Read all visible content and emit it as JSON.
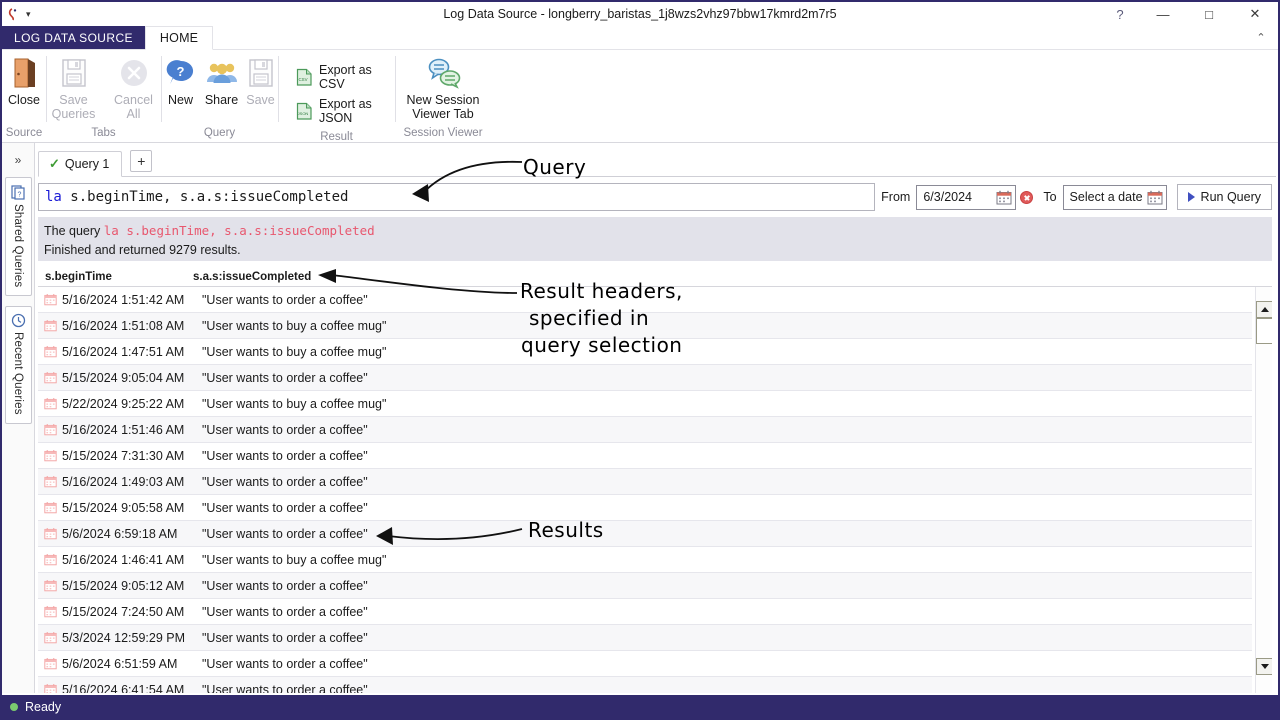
{
  "window": {
    "title": "Log Data Source - longberry_baristas_1j8wzs2vhz97bbw17kmrd2m7r5",
    "help_icon": "?",
    "minimize_icon": "—",
    "maximize_icon": "□",
    "close_icon": "✕",
    "qat_dropdown_icon": "▾",
    "ribbon_collapse_icon": "⌃",
    "accent_color": "#312a6c"
  },
  "ribbon": {
    "file_tab": "LOG DATA SOURCE",
    "home_tab": "HOME",
    "groups": [
      {
        "label": "Source",
        "buttons": [
          {
            "label": "Close",
            "icon": "door-icon",
            "disabled": false
          }
        ]
      },
      {
        "label": "Tabs",
        "buttons": [
          {
            "label": "Save\nQueries",
            "line1": "Save",
            "line2": "Queries",
            "icon": "floppy-disk-icon",
            "disabled": true
          },
          {
            "label": "Cancel\nAll",
            "line1": "Cancel",
            "line2": "All",
            "icon": "cancel-circle-icon",
            "disabled": true
          }
        ]
      },
      {
        "label": "Query",
        "buttons": [
          {
            "label": "New",
            "icon": "question-bubble-icon",
            "disabled": false
          },
          {
            "label": "Share",
            "icon": "people-icon",
            "disabled": false
          },
          {
            "label": "Save",
            "icon": "floppy-disk-icon",
            "disabled": true
          }
        ]
      },
      {
        "label": "Result",
        "small_buttons": [
          {
            "label": "Export as CSV",
            "icon": "csv-file-icon"
          },
          {
            "label": "Export as JSON",
            "icon": "json-file-icon"
          }
        ]
      },
      {
        "label": "Session Viewer",
        "buttons": [
          {
            "label": "New Session\nViewer Tab",
            "line1": "New Session",
            "line2": "Viewer Tab",
            "icon": "chat-bubbles-icon",
            "disabled": false
          }
        ]
      }
    ]
  },
  "rail": {
    "expand_icon": "»",
    "tabs": [
      {
        "label": "Shared Queries",
        "icon": "shared-queries-icon"
      },
      {
        "label": "Recent Queries",
        "icon": "clock-icon"
      }
    ]
  },
  "query_tabs": {
    "tabs": [
      {
        "label": "Query 1",
        "status_icon": "check-icon"
      }
    ],
    "add_tab_icon": "+"
  },
  "query_bar": {
    "keyword": "la",
    "rest": " s.beginTime, s.a.s:issueCompleted",
    "from_label": "From",
    "from_value": "6/3/2024",
    "to_label": "To",
    "to_placeholder": "Select a date",
    "calendar_icon": "calendar-icon",
    "clear_icon": "clear-date-icon",
    "run_label": "Run Query",
    "run_icon": "play-icon"
  },
  "status_block": {
    "prefix": "The query ",
    "query_text": "la s.beginTime, s.a.s:issueCompleted",
    "result_line": "Finished and returned 9279 results."
  },
  "results": {
    "headers": [
      "s.beginTime",
      "s.a.s:issueCompleted"
    ],
    "row_icon": "calendar-icon",
    "rows": [
      {
        "time": "5/16/2024 1:51:42 AM",
        "message": "\"User wants to order a coffee\""
      },
      {
        "time": "5/16/2024 1:51:08 AM",
        "message": "\"User wants to buy a coffee mug\""
      },
      {
        "time": "5/16/2024 1:47:51 AM",
        "message": "\"User wants to buy a coffee mug\""
      },
      {
        "time": "5/15/2024 9:05:04 AM",
        "message": "\"User wants to order a coffee\""
      },
      {
        "time": "5/22/2024 9:25:22 AM",
        "message": "\"User wants to buy a coffee mug\""
      },
      {
        "time": "5/16/2024 1:51:46 AM",
        "message": "\"User wants to order a coffee\""
      },
      {
        "time": "5/15/2024 7:31:30 AM",
        "message": "\"User wants to order a coffee\""
      },
      {
        "time": "5/16/2024 1:49:03 AM",
        "message": "\"User wants to order a coffee\""
      },
      {
        "time": "5/15/2024 9:05:58 AM",
        "message": "\"User wants to order a coffee\""
      },
      {
        "time": "5/6/2024 6:59:18 AM",
        "message": "\"User wants to order a coffee\""
      },
      {
        "time": "5/16/2024 1:46:41 AM",
        "message": "\"User wants to buy a coffee mug\""
      },
      {
        "time": "5/15/2024 9:05:12 AM",
        "message": "\"User wants to order a coffee\""
      },
      {
        "time": "5/15/2024 7:24:50 AM",
        "message": "\"User wants to order a coffee\""
      },
      {
        "time": "5/3/2024 12:59:29 PM",
        "message": "\"User wants to order a coffee\""
      },
      {
        "time": "5/6/2024 6:51:59 AM",
        "message": "\"User wants to order a coffee\""
      },
      {
        "time": "5/16/2024 6:41:54 AM",
        "message": "\"User wants to order a coffee\""
      }
    ]
  },
  "scrollbar": {
    "up_icon": "scroll-up-icon",
    "down_icon": "scroll-down-icon"
  },
  "statusbar": {
    "text": "Ready",
    "indicator_color": "#7bc96f"
  },
  "annotations": [
    {
      "text": "Query"
    },
    {
      "text": "Result headers,",
      "text2": "specified in",
      "text3": "query selection"
    },
    {
      "text": "Results"
    }
  ]
}
